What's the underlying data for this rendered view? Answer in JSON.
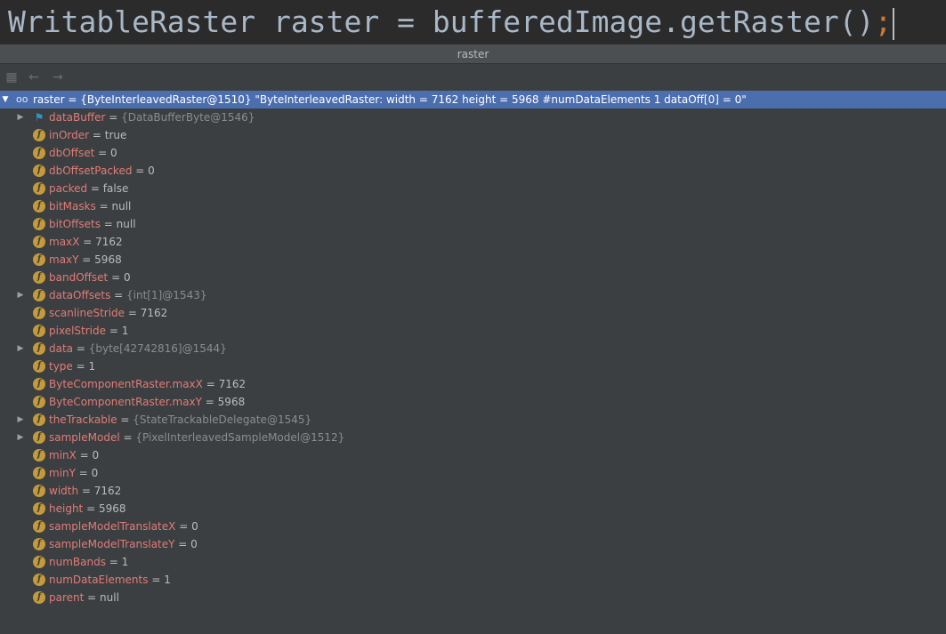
{
  "code_line": {
    "text": "WritableRaster raster = bufferedImage.getRaster()",
    "semicolon": ";"
  },
  "panel": {
    "title": "raster"
  },
  "toolbar": {
    "icons": [
      "restore-layout-icon",
      "back-arrow-icon",
      "forward-arrow-icon"
    ]
  },
  "root": {
    "name": "raster",
    "value": " = {ByteInterleavedRaster@1510} \"ByteInterleavedRaster: width = 7162 height = 5968 #numDataElements 1 dataOff[0] = 0\""
  },
  "fields": [
    {
      "name": "dataBuffer",
      "eq": " = ",
      "value": "{DataBufferByte@1546}",
      "expandable": true,
      "icon": "flag"
    },
    {
      "name": "inOrder",
      "eq": " = ",
      "value": "true",
      "expandable": false,
      "icon": "f"
    },
    {
      "name": "dbOffset",
      "eq": " = ",
      "value": "0",
      "expandable": false,
      "icon": "f"
    },
    {
      "name": "dbOffsetPacked",
      "eq": " = ",
      "value": "0",
      "expandable": false,
      "icon": "f"
    },
    {
      "name": "packed",
      "eq": " = ",
      "value": "false",
      "expandable": false,
      "icon": "f"
    },
    {
      "name": "bitMasks",
      "eq": " = ",
      "value": "null",
      "expandable": false,
      "icon": "f"
    },
    {
      "name": "bitOffsets",
      "eq": " = ",
      "value": "null",
      "expandable": false,
      "icon": "f"
    },
    {
      "name": "maxX",
      "eq": " = ",
      "value": "7162",
      "expandable": false,
      "icon": "f"
    },
    {
      "name": "maxY",
      "eq": " = ",
      "value": "5968",
      "expandable": false,
      "icon": "f"
    },
    {
      "name": "bandOffset",
      "eq": " = ",
      "value": "0",
      "expandable": false,
      "icon": "f"
    },
    {
      "name": "dataOffsets",
      "eq": " = ",
      "value": "{int[1]@1543}",
      "expandable": true,
      "icon": "f"
    },
    {
      "name": "scanlineStride",
      "eq": " = ",
      "value": "7162",
      "expandable": false,
      "icon": "f"
    },
    {
      "name": "pixelStride",
      "eq": " = ",
      "value": "1",
      "expandable": false,
      "icon": "f"
    },
    {
      "name": "data",
      "eq": " = ",
      "value": "{byte[42742816]@1544}",
      "expandable": true,
      "icon": "f"
    },
    {
      "name": "type",
      "eq": " = ",
      "value": "1",
      "expandable": false,
      "icon": "f"
    },
    {
      "name": "ByteComponentRaster.maxX",
      "eq": " = ",
      "value": "7162",
      "expandable": false,
      "icon": "f"
    },
    {
      "name": "ByteComponentRaster.maxY",
      "eq": " = ",
      "value": "5968",
      "expandable": false,
      "icon": "f"
    },
    {
      "name": "theTrackable",
      "eq": " = ",
      "value": "{StateTrackableDelegate@1545}",
      "expandable": true,
      "icon": "f"
    },
    {
      "name": "sampleModel",
      "eq": " = ",
      "value": "{PixelInterleavedSampleModel@1512}",
      "expandable": true,
      "icon": "f"
    },
    {
      "name": "minX",
      "eq": " = ",
      "value": "0",
      "expandable": false,
      "icon": "f"
    },
    {
      "name": "minY",
      "eq": " = ",
      "value": "0",
      "expandable": false,
      "icon": "f"
    },
    {
      "name": "width",
      "eq": " = ",
      "value": "7162",
      "expandable": false,
      "icon": "f"
    },
    {
      "name": "height",
      "eq": " = ",
      "value": "5968",
      "expandable": false,
      "icon": "f"
    },
    {
      "name": "sampleModelTranslateX",
      "eq": " = ",
      "value": "0",
      "expandable": false,
      "icon": "f"
    },
    {
      "name": "sampleModelTranslateY",
      "eq": " = ",
      "value": "0",
      "expandable": false,
      "icon": "f"
    },
    {
      "name": "numBands",
      "eq": " = ",
      "value": "1",
      "expandable": false,
      "icon": "f"
    },
    {
      "name": "numDataElements",
      "eq": " = ",
      "value": "1",
      "expandable": false,
      "icon": "f"
    },
    {
      "name": "parent",
      "eq": " = ",
      "value": "null",
      "expandable": false,
      "icon": "f"
    }
  ],
  "colors": {
    "selection": "#4b6eaf",
    "field_name": "#e07c77",
    "field_icon": "#c49a3a",
    "flag_icon": "#3592c4"
  }
}
